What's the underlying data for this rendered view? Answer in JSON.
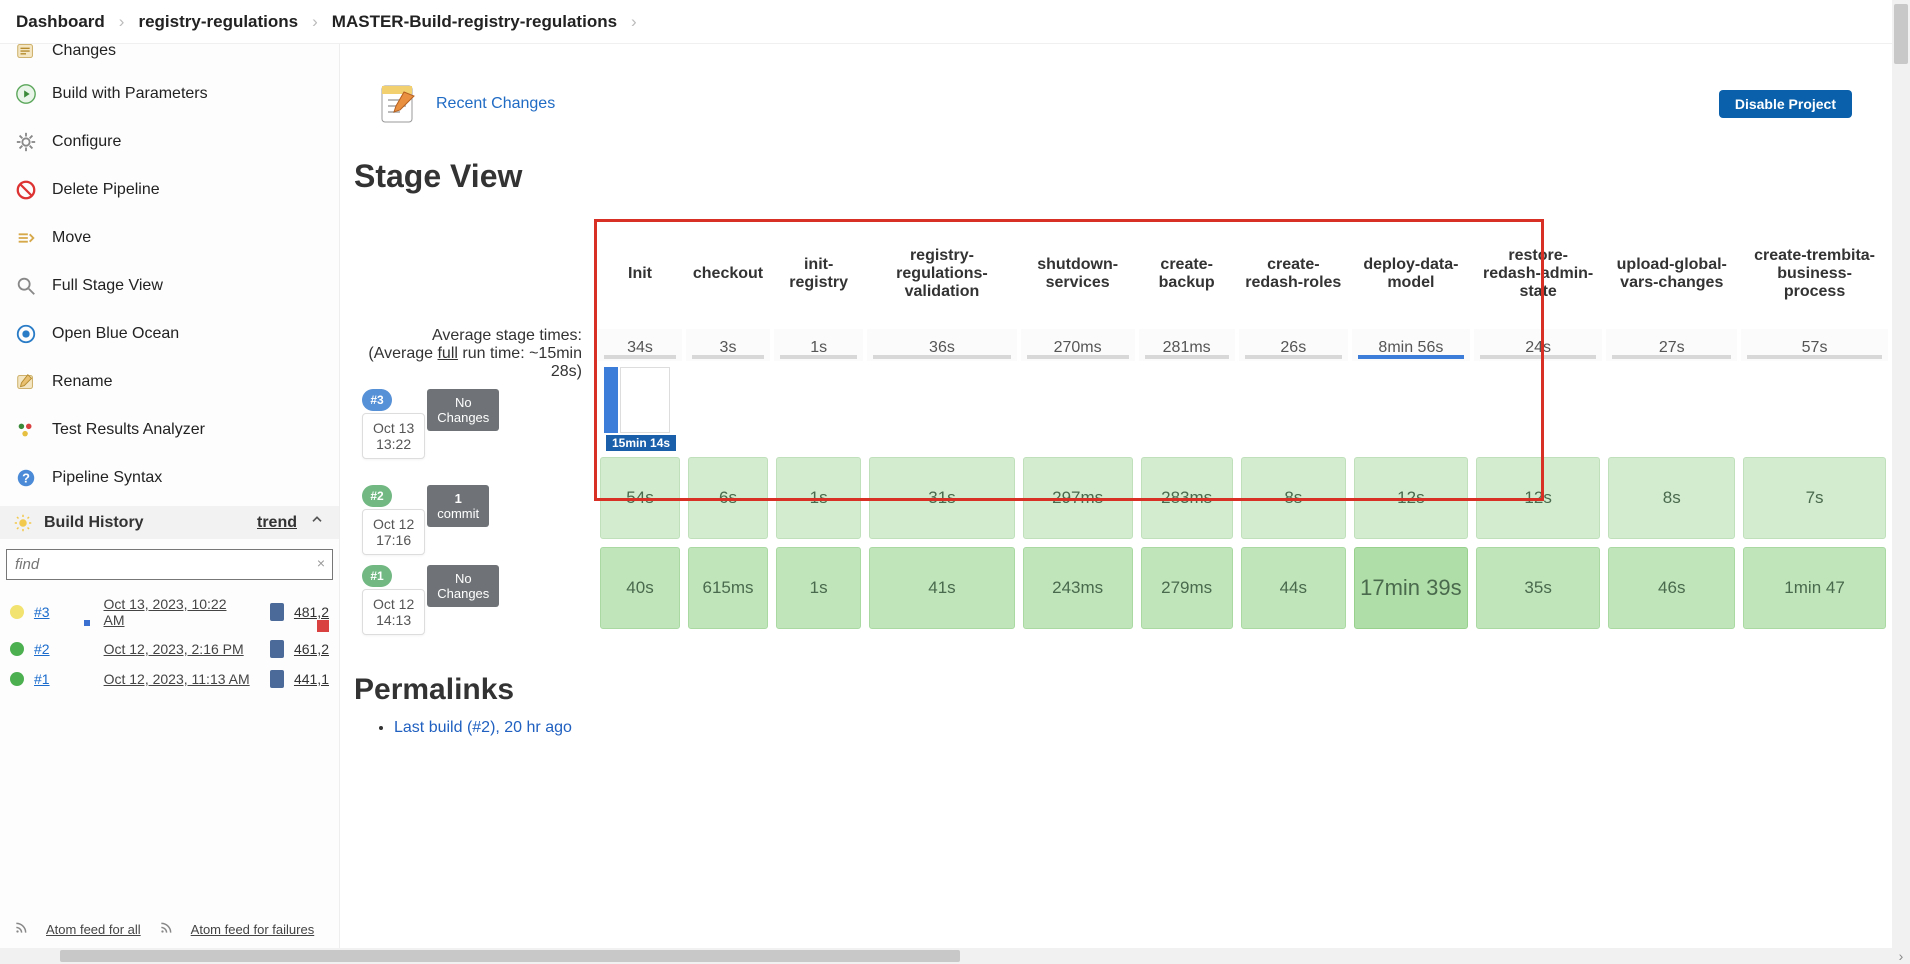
{
  "breadcrumbs": [
    "Dashboard",
    "registry-regulations",
    "MASTER-Build-registry-regulations"
  ],
  "disable_btn": "Disable Project",
  "recent_changes": "Recent Changes",
  "sidebar": {
    "changes": "Changes",
    "build": "Build with Parameters",
    "configure": "Configure",
    "delete": "Delete Pipeline",
    "move": "Move",
    "full_stage": "Full Stage View",
    "blue_ocean": "Open Blue Ocean",
    "rename": "Rename",
    "test_results": "Test Results Analyzer",
    "syntax": "Pipeline Syntax"
  },
  "build_history": {
    "title": "Build History",
    "trend": "trend",
    "find_placeholder": "find",
    "builds": [
      {
        "num": "#3",
        "date": "Oct 13, 2023, 10:22 AM",
        "size": "481,2"
      },
      {
        "num": "#2",
        "date": "Oct 12, 2023, 2:16 PM",
        "size": "461,2"
      },
      {
        "num": "#1",
        "date": "Oct 12, 2023, 11:13 AM",
        "size": "441,1"
      }
    ],
    "atom_all": "Atom feed for all",
    "atom_fail": "Atom feed for failures"
  },
  "stage_view": {
    "title": "Stage View",
    "avg_label1": "Average stage times:",
    "avg_label2a": "(Average",
    "avg_label2b": "full",
    "avg_label2c": "run time: ~15min",
    "avg_label3": "28s)",
    "stages": [
      "Init",
      "checkout",
      "init-registry",
      "registry-regulations-validation",
      "shutdown-services",
      "create-backup",
      "create-redash-roles",
      "deploy-data-model",
      "restore-redash-admin-state",
      "upload-global-vars-changes",
      "create-trembita-business-process"
    ],
    "avg_times": [
      "34s",
      "3s",
      "1s",
      "36s",
      "270ms",
      "281ms",
      "26s",
      "8min 56s",
      "24s",
      "27s",
      "57s"
    ],
    "avg_bar_blue_index": 7,
    "runs": [
      {
        "id": "#3",
        "date": "Oct 13",
        "time": "13:22",
        "changes_l1": "No",
        "changes_l2": "Changes",
        "running_time": "15min 14s",
        "cells": []
      },
      {
        "id": "#2",
        "date": "Oct 12",
        "time": "17:16",
        "changes_l1": "1",
        "changes_l2": "commit",
        "cells": [
          "54s",
          "6s",
          "1s",
          "31s",
          "297ms",
          "283ms",
          "8s",
          "12s",
          "12s",
          "8s",
          "7s"
        ],
        "shade": "l"
      },
      {
        "id": "#1",
        "date": "Oct 12",
        "time": "14:13",
        "changes_l1": "No",
        "changes_l2": "Changes",
        "cells": [
          "40s",
          "615ms",
          "1s",
          "41s",
          "243ms",
          "279ms",
          "44s",
          "17min 39s",
          "35s",
          "46s",
          "1min 47"
        ],
        "shade": "m",
        "dark_index": 7
      }
    ]
  },
  "permalinks": {
    "title": "Permalinks",
    "items": [
      {
        "label": "Last build (#2), 20 hr ago",
        "suffix": ""
      }
    ]
  }
}
